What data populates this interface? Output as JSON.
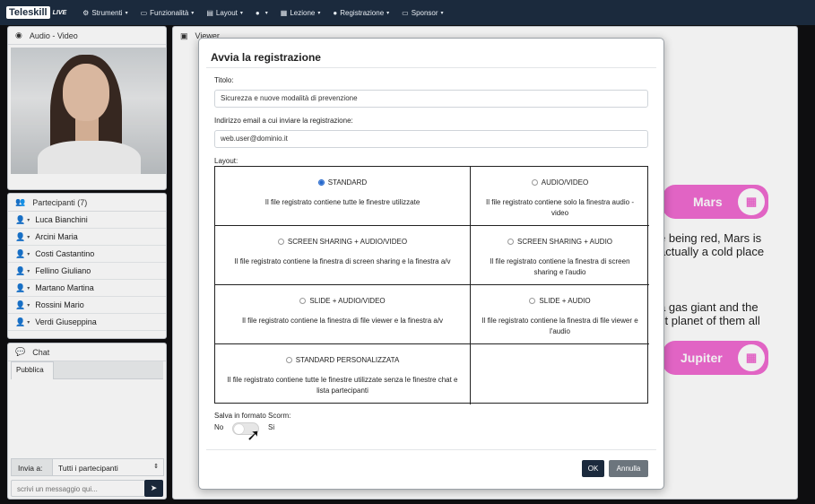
{
  "app": {
    "logo": "Teleskill",
    "logo_suffix": "LIVE"
  },
  "nav": [
    {
      "icon": "gear-icon",
      "glyph": "⚙",
      "label": "Strumenti"
    },
    {
      "icon": "window-icon",
      "glyph": "▭",
      "label": "Funzionalità"
    },
    {
      "icon": "layout-icon",
      "glyph": "▤",
      "label": "Layout"
    },
    {
      "icon": "user-icon",
      "glyph": "●",
      "label": ""
    },
    {
      "icon": "lesson-icon",
      "glyph": "▦",
      "label": "Lezione"
    },
    {
      "icon": "record-icon",
      "glyph": "●",
      "label": "Registrazione"
    },
    {
      "icon": "sponsor-icon",
      "glyph": "▭",
      "label": "Sponsor"
    }
  ],
  "audio_video": {
    "title": "Audio - Video"
  },
  "participants": {
    "title": "Partecipanti (7)",
    "items": [
      {
        "name": "Luca Bianchini",
        "color": "#d9534f"
      },
      {
        "name": "Arcini Maria",
        "color": "#3a7bd5"
      },
      {
        "name": "Costi Castantino",
        "color": "#3a7bd5"
      },
      {
        "name": "Fellino Giuliano",
        "color": "#3a7bd5"
      },
      {
        "name": "Martano Martina",
        "color": "#3a7bd5"
      },
      {
        "name": "Rossini Mario",
        "color": "#3a7bd5"
      },
      {
        "name": "Verdi Giuseppina",
        "color": "#3a7bd5"
      }
    ]
  },
  "chat": {
    "title": "Chat",
    "tab": "Pubblica",
    "send_to_label": "Invia a:",
    "send_to_value": "Tutti i partecipanti",
    "message_placeholder": "scrivi un messaggio qui..."
  },
  "viewer": {
    "title": "Viewer",
    "mars_label": "Mars",
    "mars_text_1": "e being red, Mars is",
    "mars_text_2": "actually a cold place",
    "jupiter_text_1": "a gas giant and the",
    "jupiter_text_2": "st planet of them all",
    "jupiter_label": "Jupiter",
    "accent": "#f06bd1"
  },
  "modal": {
    "title": "Avvia la registrazione",
    "title_label": "Titolo:",
    "title_value": "Sicurezza e nuove modalità di prevenzione",
    "email_label": "Indirizzo email a cui inviare la registrazione:",
    "email_value": "web.user@dominio.it",
    "layout_label": "Layout:",
    "options": [
      {
        "label": "STANDARD",
        "desc": "Il file registrato contiene tutte le finestre utilizzate",
        "selected": true
      },
      {
        "label": "AUDIO/VIDEO",
        "desc": "Il file registrato contiene solo la finestra audio - video",
        "selected": false
      },
      {
        "label": "SCREEN SHARING + AUDIO/VIDEO",
        "desc": "Il file registrato contiene la finestra di screen sharing e la finestra a/v",
        "selected": false
      },
      {
        "label": "SCREEN SHARING + AUDIO",
        "desc": "Il file registrato contiene la finestra di screen sharing e l'audio",
        "selected": false
      },
      {
        "label": "SLIDE + AUDIO/VIDEO",
        "desc": "Il file registrato contiene la finestra di file viewer e la finestra a/v",
        "selected": false
      },
      {
        "label": "SLIDE + AUDIO",
        "desc": "Il file registrato contiene la finestra di file viewer e l'audio",
        "selected": false
      },
      {
        "label": "STANDARD PERSONALIZZATA",
        "desc": "Il file registrato contiene tutte le finestre utilizzate senza le finestre chat e lista partecipanti",
        "selected": false
      }
    ],
    "scorm_label": "Salva in formato Scorm:",
    "scorm_no": "No",
    "scorm_yes": "Si",
    "scorm_enabled": false,
    "ok_label": "OK",
    "cancel_label": "Annulla",
    "ok_color": "#1b2a3d",
    "cancel_color": "#6c757d"
  }
}
